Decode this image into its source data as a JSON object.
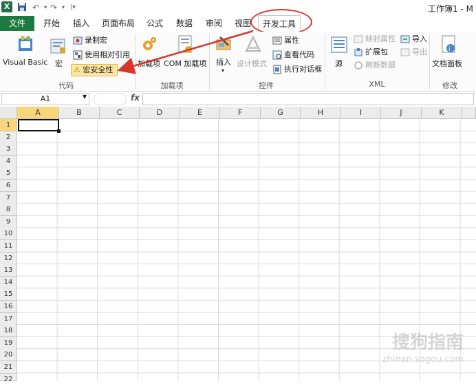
{
  "app": {
    "icon_label": "X",
    "window_title": "工作簿1 - M"
  },
  "quick_access": {
    "save_icon": "save-icon",
    "undo_icon": "undo-icon",
    "redo_icon": "redo-icon",
    "customize_icon": "customize-icon"
  },
  "tabs": [
    {
      "label": "文件"
    },
    {
      "label": "开始"
    },
    {
      "label": "插入"
    },
    {
      "label": "页面布局"
    },
    {
      "label": "公式"
    },
    {
      "label": "数据"
    },
    {
      "label": "审阅"
    },
    {
      "label": "视图"
    },
    {
      "label": "开发工具"
    }
  ],
  "ribbon": {
    "code": {
      "visual_basic": "Visual Basic",
      "macros": "宏",
      "record_macro": "录制宏",
      "relative_ref": "使用相对引用",
      "macro_security": "宏安全性",
      "label": "代码"
    },
    "addins": {
      "addins": "加载项",
      "com_addins": "COM 加载项",
      "label": "加载项"
    },
    "controls": {
      "insert": "插入",
      "design_mode": "设计模式",
      "properties": "属性",
      "view_code": "查看代码",
      "run_dialog": "执行对话框",
      "label": "控件"
    },
    "xml": {
      "source": "源",
      "map_properties": "映射属性",
      "expansion_packs": "扩展包",
      "refresh_data": "刷新数据",
      "import": "导入",
      "export": "导出",
      "label": "XML"
    },
    "modify": {
      "document_panel": "文档面板",
      "label": "修改"
    }
  },
  "formula_bar": {
    "name_box": "A1",
    "fx": "fx",
    "formula": ""
  },
  "grid": {
    "columns": [
      "A",
      "B",
      "C",
      "D",
      "E",
      "F",
      "G",
      "H",
      "I",
      "J",
      "K"
    ],
    "rows": [
      "1",
      "2",
      "3",
      "4",
      "5",
      "6",
      "7",
      "8",
      "9",
      "10",
      "11",
      "12",
      "13",
      "14",
      "15",
      "16",
      "17",
      "18",
      "19",
      "20",
      "21",
      "22"
    ],
    "active_cell": "A1"
  },
  "watermark": {
    "text": "搜狗指南",
    "url": "zhinan.sogou.com"
  },
  "colors": {
    "file_tab": "#1d7a3e",
    "annotation": "#d9352b",
    "highlight": "#fde7a1"
  }
}
